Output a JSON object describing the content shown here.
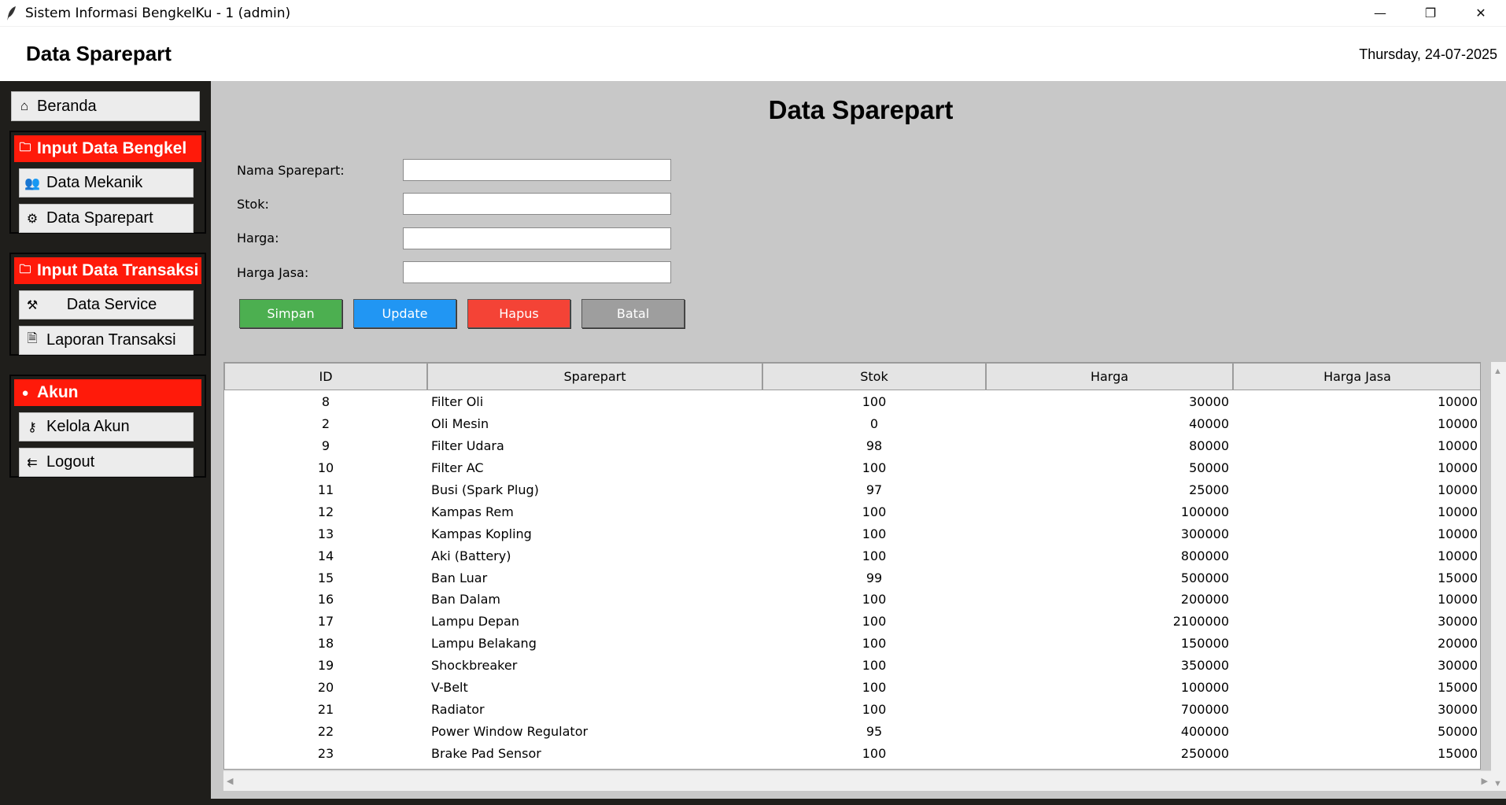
{
  "window": {
    "title": "Sistem Informasi BengkelKu - 1 (admin)",
    "controls": {
      "minimize": "—",
      "restore": "❐",
      "close": "✕"
    }
  },
  "header": {
    "title": "Data Sparepart",
    "date": "Thursday, 24-07-2025"
  },
  "sidebar": {
    "home": {
      "label": "Beranda",
      "icon": "home-icon"
    },
    "groups": [
      {
        "title": "Input Data Bengkel",
        "icon": "folder-icon",
        "items": [
          {
            "label": "Data Mekanik",
            "icon": "users-icon"
          },
          {
            "label": "Data Sparepart",
            "icon": "gear-icon"
          }
        ]
      },
      {
        "title": "Input Data Transaksi",
        "icon": "folder-icon",
        "items": [
          {
            "label": "Data Service",
            "icon": "tools-icon"
          },
          {
            "label": "Laporan Transaksi",
            "icon": "document-icon"
          }
        ]
      },
      {
        "title": "Akun",
        "icon": "user-icon",
        "items": [
          {
            "label": "Kelola Akun",
            "icon": "key-icon"
          },
          {
            "label": "Logout",
            "icon": "logout-icon"
          }
        ]
      }
    ]
  },
  "form": {
    "title": "Data Sparepart",
    "fields": [
      {
        "label": "Nama Sparepart:",
        "value": ""
      },
      {
        "label": "Stok:",
        "value": ""
      },
      {
        "label": "Harga:",
        "value": ""
      },
      {
        "label": "Harga Jasa:",
        "value": ""
      }
    ],
    "buttons": [
      {
        "label": "Simpan",
        "color": "#4caf50"
      },
      {
        "label": "Update",
        "color": "#2196f3"
      },
      {
        "label": "Hapus",
        "color": "#f44336"
      },
      {
        "label": "Batal",
        "color": "#9e9e9e"
      }
    ]
  },
  "table": {
    "columns": [
      "ID",
      "Sparepart",
      "Stok",
      "Harga",
      "Harga Jasa"
    ],
    "rows": [
      [
        "8",
        "Filter Oli",
        "100",
        "30000",
        "10000"
      ],
      [
        "2",
        "Oli Mesin",
        "0",
        "40000",
        "10000"
      ],
      [
        "9",
        "Filter Udara",
        "98",
        "80000",
        "10000"
      ],
      [
        "10",
        "Filter AC",
        "100",
        "50000",
        "10000"
      ],
      [
        "11",
        "Busi (Spark Plug)",
        "97",
        "25000",
        "10000"
      ],
      [
        "12",
        "Kampas Rem",
        "100",
        "100000",
        "10000"
      ],
      [
        "13",
        "Kampas Kopling",
        "100",
        "300000",
        "10000"
      ],
      [
        "14",
        "Aki (Battery)",
        "100",
        "800000",
        "10000"
      ],
      [
        "15",
        "Ban Luar",
        "99",
        "500000",
        "15000"
      ],
      [
        "16",
        "Ban Dalam",
        "100",
        "200000",
        "10000"
      ],
      [
        "17",
        "Lampu Depan",
        "100",
        "2100000",
        "30000"
      ],
      [
        "18",
        "Lampu Belakang",
        "100",
        "150000",
        "20000"
      ],
      [
        "19",
        "Shockbreaker",
        "100",
        "350000",
        "30000"
      ],
      [
        "20",
        "V-Belt",
        "100",
        "100000",
        "15000"
      ],
      [
        "21",
        "Radiator",
        "100",
        "700000",
        "30000"
      ],
      [
        "22",
        "Power Window Regulator",
        "95",
        "400000",
        "50000"
      ],
      [
        "23",
        "Brake Pad Sensor",
        "100",
        "250000",
        "15000"
      ]
    ]
  }
}
